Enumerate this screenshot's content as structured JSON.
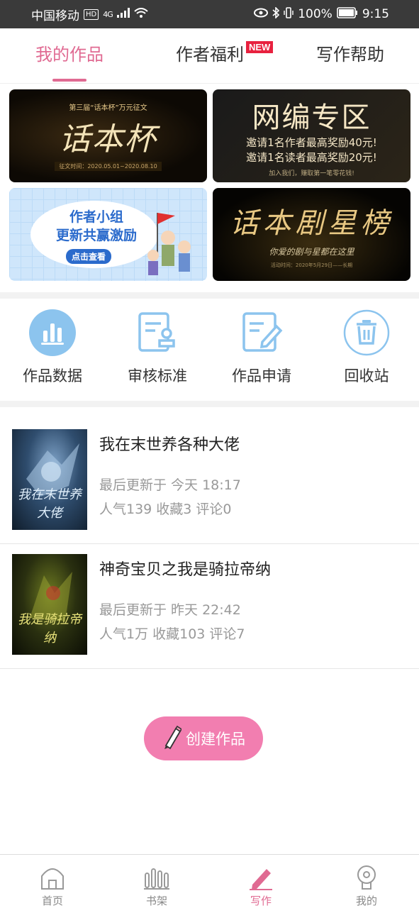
{
  "status_bar": {
    "carrier": "中国移动",
    "hd": "HD",
    "network": "4G",
    "battery": "100%",
    "time": "9:15"
  },
  "tabs": [
    {
      "label": "我的作品",
      "active": true
    },
    {
      "label": "作者福利",
      "active": false
    },
    {
      "label": "写作帮助",
      "active": false
    }
  ],
  "new_badge": "NEW",
  "banners": {
    "b1": {
      "small": "第三届“话本杯”万元征文",
      "big": "话本杯",
      "date": "征文时间：2020.05.01~2020.08.10"
    },
    "b2": {
      "title": "网编专区",
      "line1": "邀请1名作者最高奖励40元!",
      "line2": "邀请1名读者最高奖励20元!",
      "foot": "加入我们，赚取第一笔零花钱!"
    },
    "b3": {
      "line1": "作者小组",
      "line2": "更新共赢激励",
      "button": "点击查看"
    },
    "b4": {
      "title": "话本剧星榜",
      "sub": "你爱的剧与星都在这里",
      "foot": "活动时间：2020年5月29日——长期"
    }
  },
  "quick_actions": [
    {
      "label": "作品数据",
      "icon": "bar-chart-icon"
    },
    {
      "label": "审核标准",
      "icon": "review-standard-icon"
    },
    {
      "label": "作品申请",
      "icon": "edit-document-icon"
    },
    {
      "label": "回收站",
      "icon": "trash-icon"
    }
  ],
  "works": [
    {
      "title": "我在末世养各种大佬",
      "update": "最后更新于 今天 18:17",
      "stats": "人气139 收藏3 评论0",
      "cover_text": "我在末世养大佬"
    },
    {
      "title": "神奇宝贝之我是骑拉帝纳",
      "update": "最后更新于 昨天 22:42",
      "stats": "人气1万 收藏103 评论7",
      "cover_text": "我是骑拉帝纳"
    }
  ],
  "create_button": "创建作品",
  "bottom_nav": [
    {
      "label": "首页",
      "icon": "home-icon",
      "active": false
    },
    {
      "label": "书架",
      "icon": "bookshelf-icon",
      "active": false
    },
    {
      "label": "写作",
      "icon": "pen-icon",
      "active": true
    },
    {
      "label": "我的",
      "icon": "profile-icon",
      "active": false
    }
  ],
  "colors": {
    "accent": "#e06a92",
    "create_button": "#f27eb0",
    "icon_blue": "#8cc4ee",
    "new_badge": "#e8213f"
  }
}
